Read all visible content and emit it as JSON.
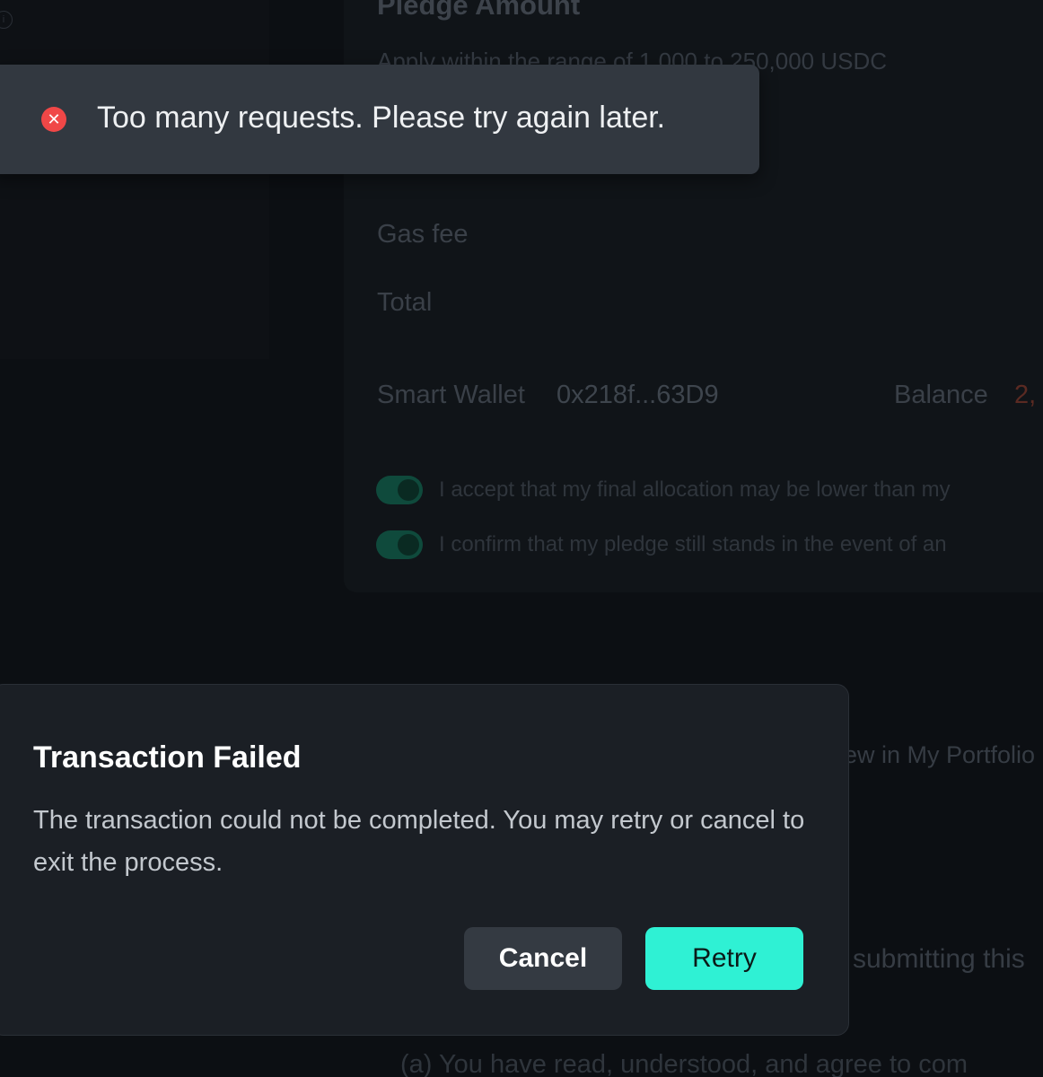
{
  "background": {
    "card_title": "Pledge Amount",
    "card_subtitle": "Apply within the range of 1,000 to 250,000 USDC",
    "gas_fee_label": "Gas fee",
    "total_label": "Total",
    "wallet_label": "Smart Wallet",
    "wallet_address": "0x218f...63D9",
    "balance_label": "Balance",
    "balance_value": "2,",
    "checkbox_1": "I accept that my final allocation may be lower than my",
    "checkbox_2": "I confirm that my pledge still stands in the event of an",
    "portfolio_link": "ew in My Portfolio",
    "submitting_text": "submitting this",
    "agree_text": "(a) You have read, understood, and agree to com"
  },
  "toast": {
    "message": "Too many requests. Please try again later.",
    "icon": "error-icon",
    "color": "#f04747"
  },
  "modal": {
    "title": "Transaction Failed",
    "body": "The transaction could not be completed. You may retry or cancel to exit the process.",
    "cancel_label": "Cancel",
    "retry_label": "Retry",
    "accent": "#2ff1d4"
  }
}
